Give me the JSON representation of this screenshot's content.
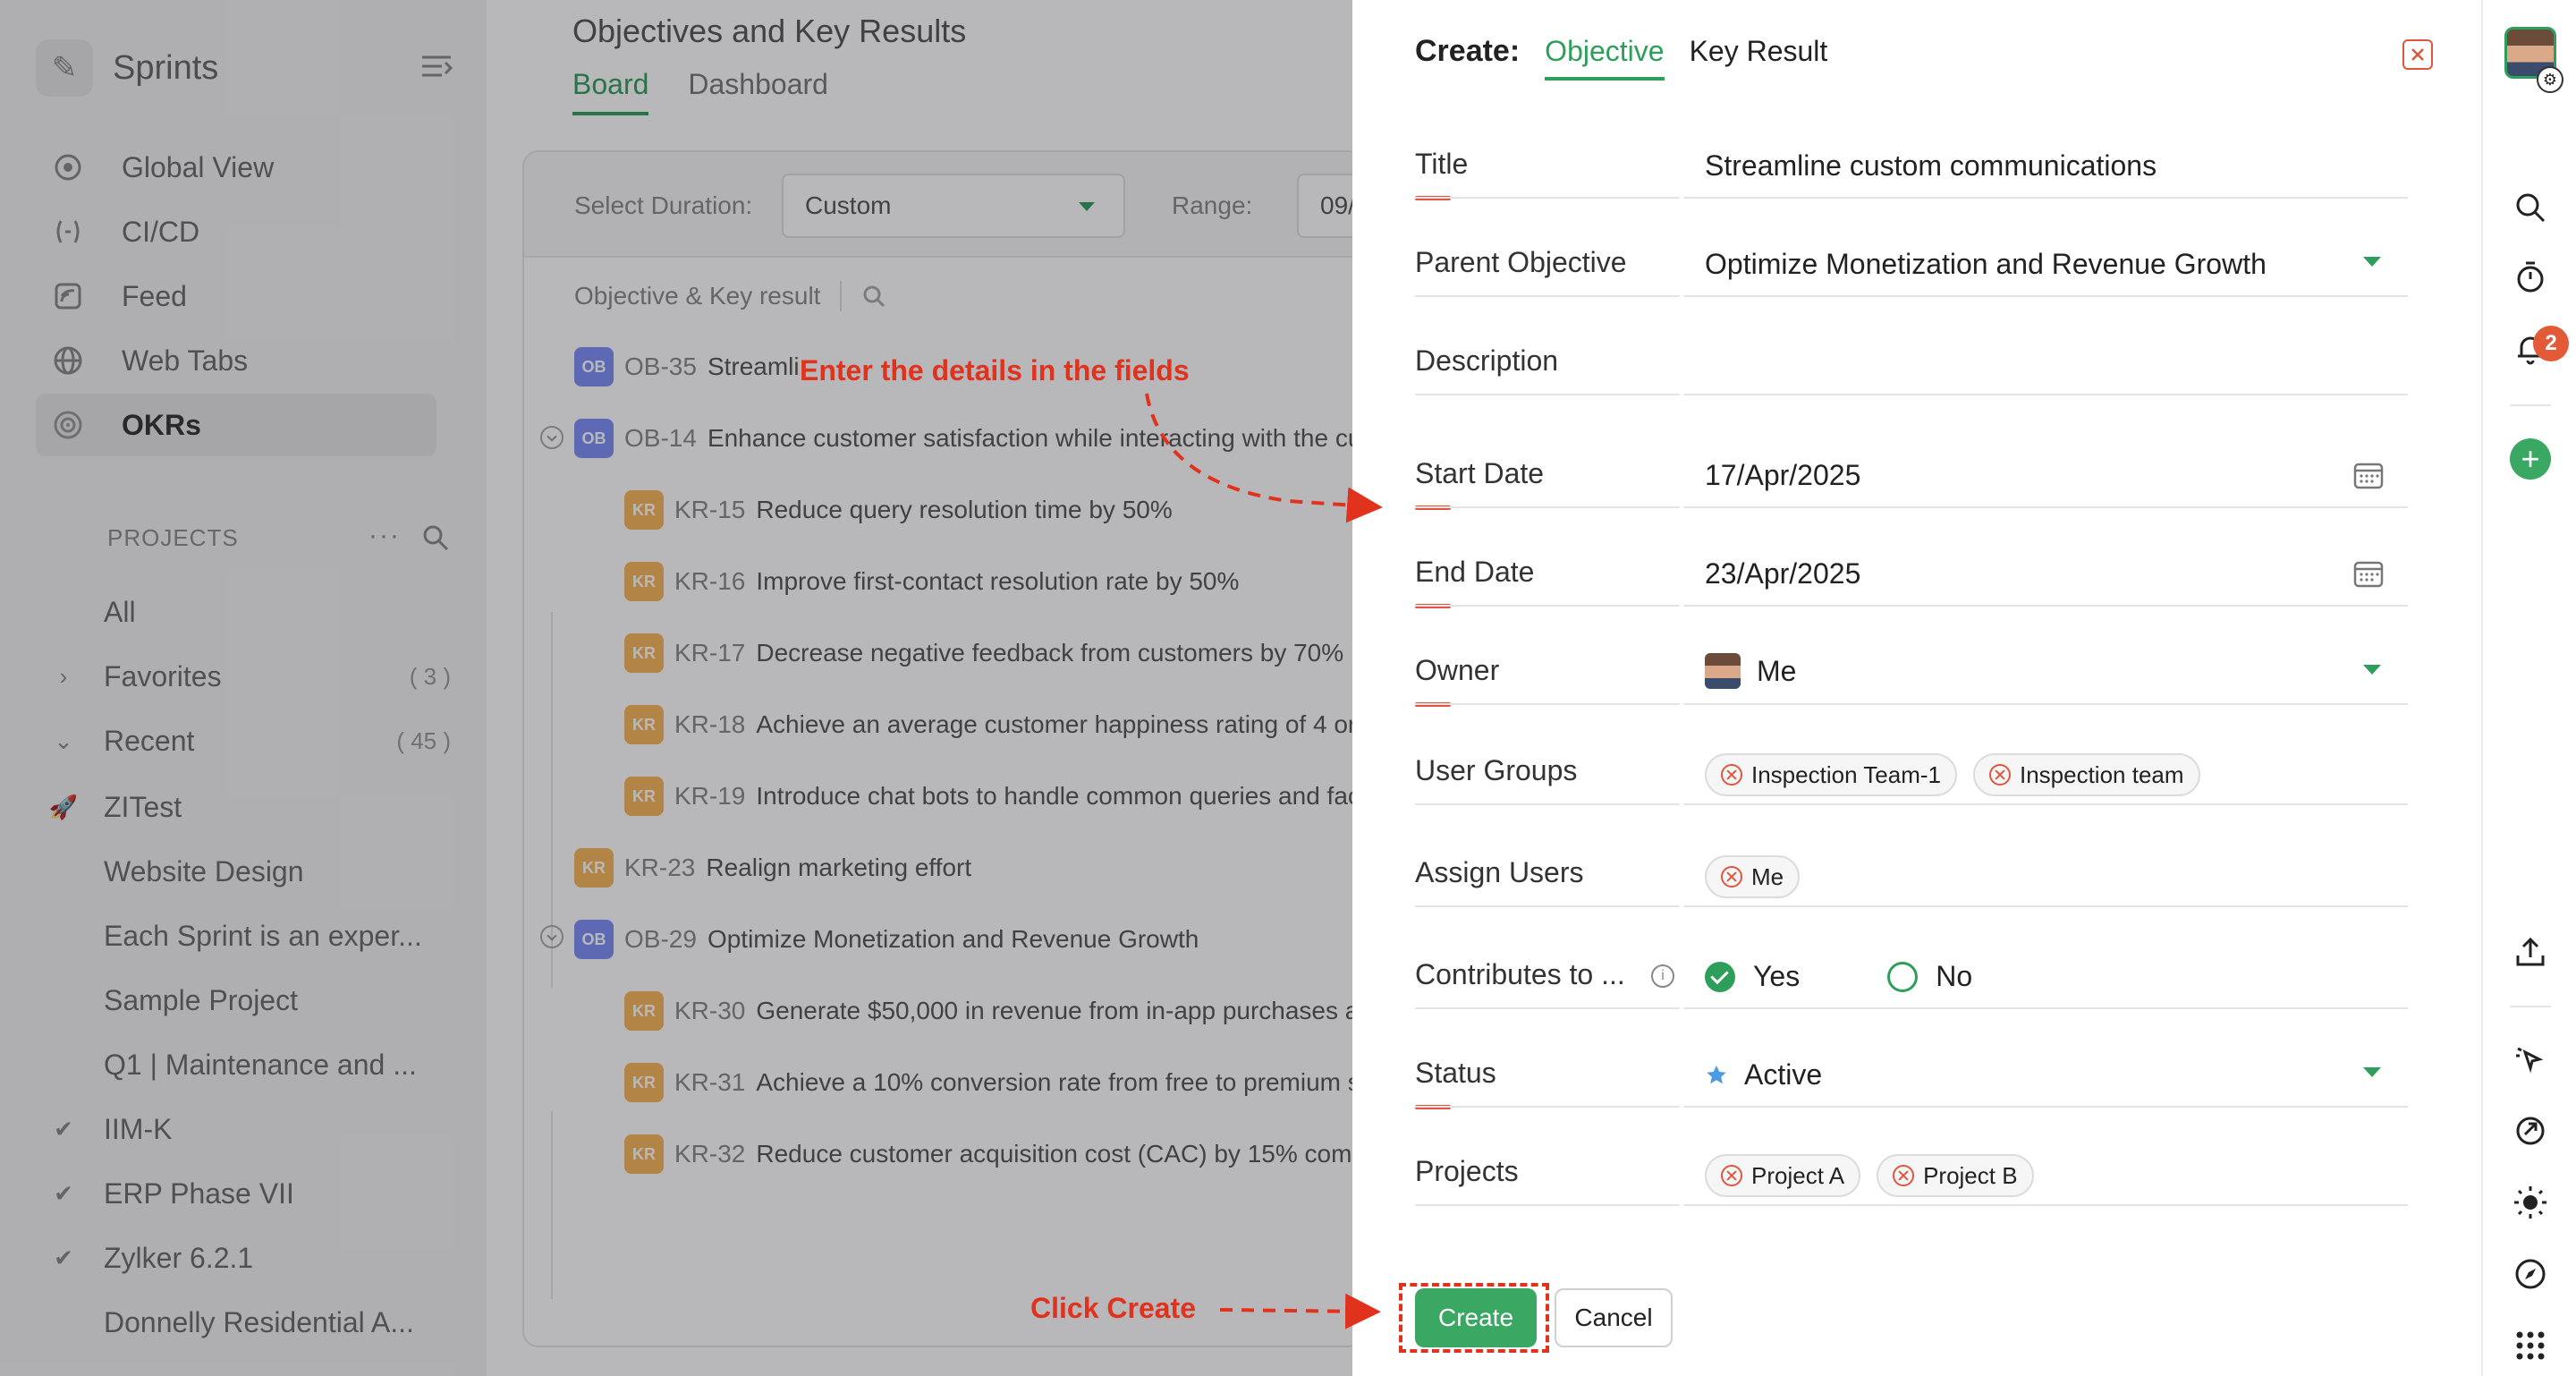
{
  "sidebar": {
    "brand": "Sprints",
    "nav": [
      {
        "label": "Global View",
        "icon": "globe-view-icon"
      },
      {
        "label": "CI/CD",
        "icon": "cicd-icon"
      },
      {
        "label": "Feed",
        "icon": "feed-icon"
      },
      {
        "label": "Web Tabs",
        "icon": "web-tabs-icon"
      },
      {
        "label": "OKRs",
        "icon": "target-icon",
        "active": true
      }
    ],
    "projects_header": "PROJECTS",
    "projects_more": "···",
    "projects": [
      {
        "label": "All"
      },
      {
        "label": "Favorites",
        "count": "( 3 )"
      },
      {
        "label": "Recent",
        "count": "( 45 )"
      },
      {
        "label": "ZITest"
      },
      {
        "label": "Website Design"
      },
      {
        "label": "Each Sprint is an exper..."
      },
      {
        "label": "Sample Project"
      },
      {
        "label": "Q1 | Maintenance and ..."
      },
      {
        "label": "IIM-K"
      },
      {
        "label": "ERP Phase VII"
      },
      {
        "label": "Zylker 6.2.1"
      },
      {
        "label": "Donnelly Residential A..."
      }
    ]
  },
  "main": {
    "title": "Objectives and Key Results",
    "tabs": [
      "Board",
      "Dashboard"
    ],
    "filter": {
      "duration_label": "Select Duration:",
      "duration_value": "Custom",
      "range_label": "Range:",
      "range_value": "09/"
    },
    "list_header": "Objective & Key result",
    "rows": [
      {
        "type": "OB",
        "code": "OB-35",
        "text": "Streamli"
      },
      {
        "type": "OB",
        "code": "OB-14",
        "text": "Enhance customer satisfaction while interacting with the cu"
      },
      {
        "type": "KR",
        "code": "KR-15",
        "text": "Reduce query resolution time by 50%"
      },
      {
        "type": "KR",
        "code": "KR-16",
        "text": "Improve first-contact resolution rate by 50%"
      },
      {
        "type": "KR",
        "code": "KR-17",
        "text": "Decrease negative feedback from customers by 70%"
      },
      {
        "type": "KR",
        "code": "KR-18",
        "text": "Achieve an average customer happiness rating of 4 or h"
      },
      {
        "type": "KR",
        "code": "KR-19",
        "text": "Introduce chat bots to handle common queries and fac"
      },
      {
        "type": "KR",
        "code": "KR-23",
        "text": "Realign marketing effort"
      },
      {
        "type": "OB",
        "code": "OB-29",
        "text": "Optimize Monetization and Revenue Growth"
      },
      {
        "type": "KR",
        "code": "KR-30",
        "text": "Generate $50,000 in revenue from in-app purchases ar"
      },
      {
        "type": "KR",
        "code": "KR-31",
        "text": "Achieve a 10% conversion rate from free to premium s"
      },
      {
        "type": "KR",
        "code": "KR-32",
        "text": "Reduce customer acquisition cost (CAC) by 15% compa"
      }
    ]
  },
  "panel": {
    "create_label": "Create:",
    "tabs": [
      "Objective",
      "Key Result"
    ],
    "fields": {
      "title": {
        "label": "Title",
        "value": "Streamline custom communications"
      },
      "parent": {
        "label": "Parent Objective",
        "value": "Optimize Monetization and Revenue Growth"
      },
      "description": {
        "label": "Description",
        "value": ""
      },
      "start": {
        "label": "Start Date",
        "value": "17/Apr/2025"
      },
      "end": {
        "label": "End Date",
        "value": "23/Apr/2025"
      },
      "owner": {
        "label": "Owner",
        "value": "Me"
      },
      "user_groups": {
        "label": "User Groups",
        "chips": [
          "Inspection Team-1",
          "Inspection team"
        ]
      },
      "assign_users": {
        "label": "Assign Users",
        "chips": [
          "Me"
        ]
      },
      "contributes": {
        "label": "Contributes to ...",
        "yes": "Yes",
        "no": "No",
        "selected": "Yes"
      },
      "status": {
        "label": "Status",
        "value": "Active"
      },
      "projects": {
        "label": "Projects",
        "chips": [
          "Project A",
          "Project B"
        ]
      }
    },
    "create_button": "Create",
    "cancel_button": "Cancel"
  },
  "annotations": {
    "fields_hint": "Enter the details in the fields",
    "create_hint": "Click Create"
  },
  "rail": {
    "notifications_count": "2"
  },
  "colors": {
    "accent": "#2e9e5b",
    "annotation": "#e0321c",
    "required": "#e0553d",
    "ob_badge": "#7d8ff2",
    "kr_badge": "#f6b75a"
  }
}
